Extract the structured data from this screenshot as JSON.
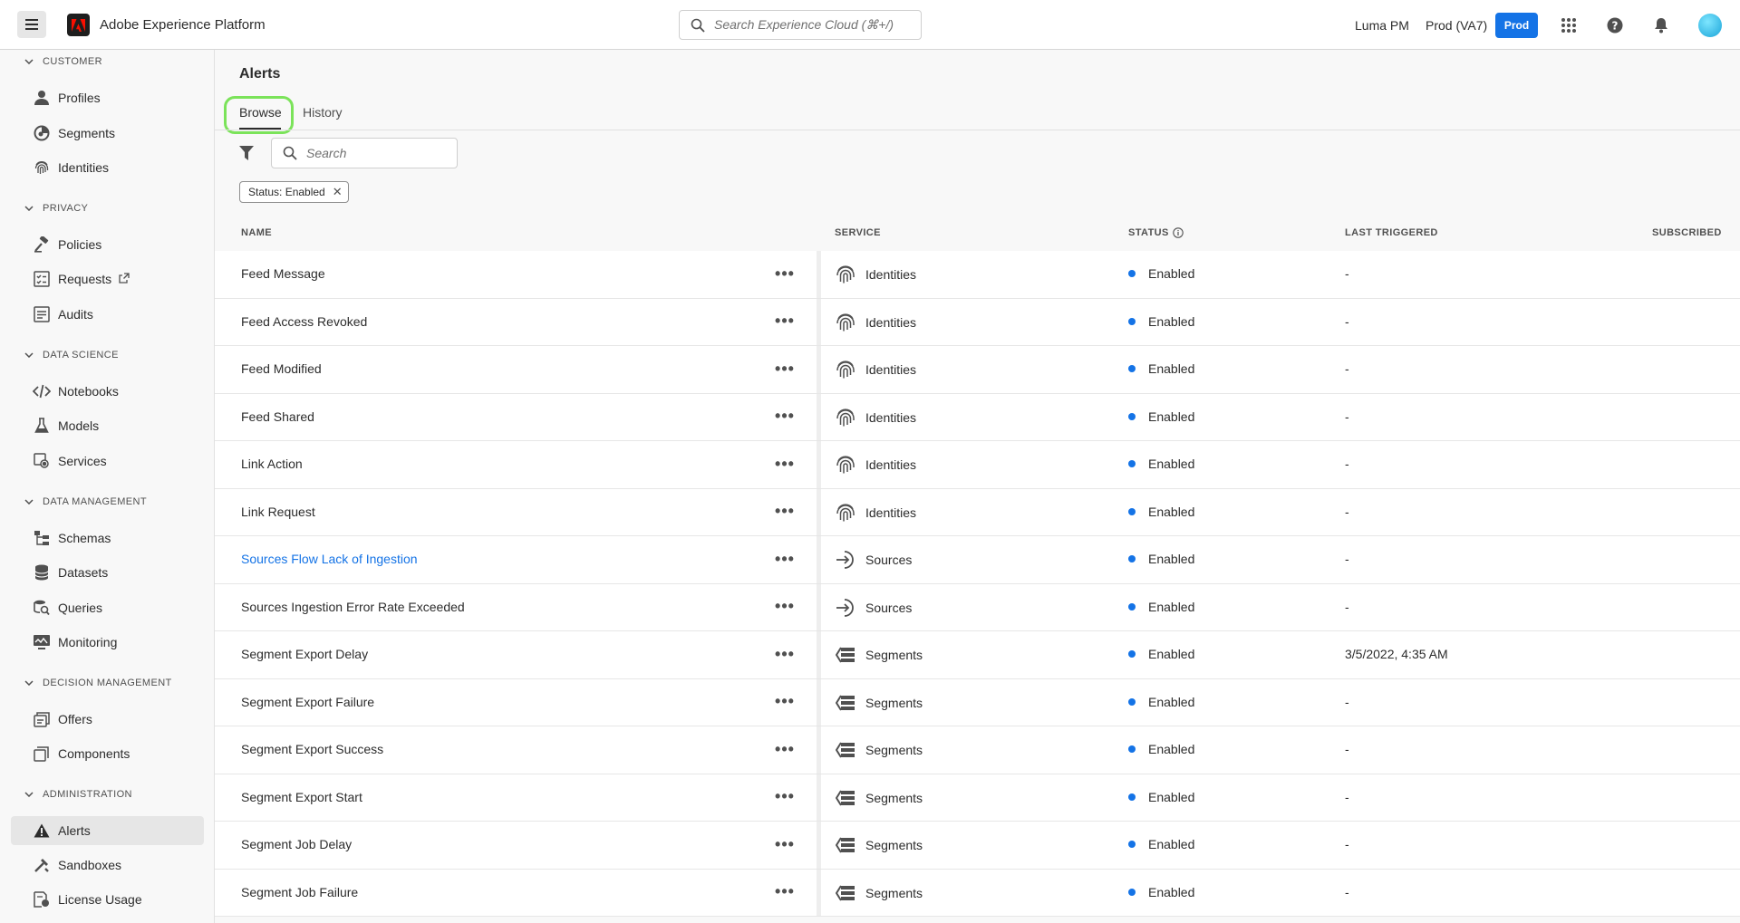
{
  "header": {
    "app_title": "Adobe Experience Platform",
    "search_placeholder": "Search Experience Cloud (⌘+/)",
    "org": "Luma PM",
    "sandbox": "Prod (VA7)",
    "sandbox_badge": "Prod"
  },
  "sidebar": {
    "sections": [
      {
        "label": "CUSTOMER",
        "items": [
          "Profiles",
          "Segments",
          "Identities"
        ]
      },
      {
        "label": "PRIVACY",
        "items": [
          "Policies",
          "Requests",
          "Audits"
        ]
      },
      {
        "label": "DATA SCIENCE",
        "items": [
          "Notebooks",
          "Models",
          "Services"
        ]
      },
      {
        "label": "DATA MANAGEMENT",
        "items": [
          "Schemas",
          "Datasets",
          "Queries",
          "Monitoring"
        ]
      },
      {
        "label": "DECISION MANAGEMENT",
        "items": [
          "Offers",
          "Components"
        ]
      },
      {
        "label": "ADMINISTRATION",
        "items": [
          "Alerts",
          "Sandboxes",
          "License Usage"
        ]
      }
    ],
    "active_item": "Alerts"
  },
  "main": {
    "title": "Alerts",
    "tabs": [
      "Browse",
      "History"
    ],
    "selected_tab": "Browse",
    "search_placeholder": "Search",
    "filter_chip": "Status: Enabled",
    "columns": [
      "NAME",
      "SERVICE",
      "STATUS",
      "LAST TRIGGERED",
      "SUBSCRIBED"
    ],
    "rows": [
      {
        "name": "Feed Message",
        "service": "Identities",
        "status": "Enabled",
        "last_triggered": "-"
      },
      {
        "name": "Feed Access Revoked",
        "service": "Identities",
        "status": "Enabled",
        "last_triggered": "-"
      },
      {
        "name": "Feed Modified",
        "service": "Identities",
        "status": "Enabled",
        "last_triggered": "-"
      },
      {
        "name": "Feed Shared",
        "service": "Identities",
        "status": "Enabled",
        "last_triggered": "-"
      },
      {
        "name": "Link Action",
        "service": "Identities",
        "status": "Enabled",
        "last_triggered": "-"
      },
      {
        "name": "Link Request",
        "service": "Identities",
        "status": "Enabled",
        "last_triggered": "-"
      },
      {
        "name": "Sources Flow Lack of Ingestion",
        "service": "Sources",
        "status": "Enabled",
        "last_triggered": "-"
      },
      {
        "name": "Sources Ingestion Error Rate Exceeded",
        "service": "Sources",
        "status": "Enabled",
        "last_triggered": "-"
      },
      {
        "name": "Segment Export Delay",
        "service": "Segments",
        "status": "Enabled",
        "last_triggered": "3/5/2022, 4:35 AM"
      },
      {
        "name": "Segment Export Failure",
        "service": "Segments",
        "status": "Enabled",
        "last_triggered": "-"
      },
      {
        "name": "Segment Export Success",
        "service": "Segments",
        "status": "Enabled",
        "last_triggered": "-"
      },
      {
        "name": "Segment Export Start",
        "service": "Segments",
        "status": "Enabled",
        "last_triggered": "-"
      },
      {
        "name": "Segment Job Delay",
        "service": "Segments",
        "status": "Enabled",
        "last_triggered": "-"
      },
      {
        "name": "Segment Job Failure",
        "service": "Segments",
        "status": "Enabled",
        "last_triggered": "-"
      }
    ]
  },
  "colors": {
    "accent": "#1473e6",
    "highlight": "#7be35a"
  }
}
